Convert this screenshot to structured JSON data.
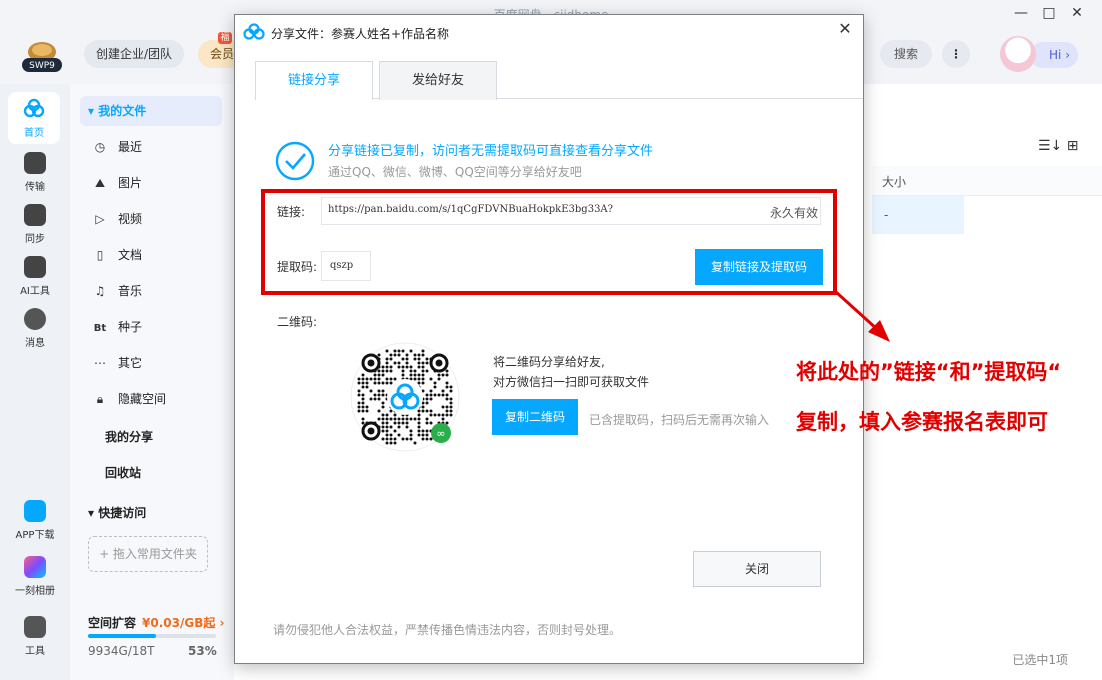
{
  "window": {
    "title": "百度网盘 - cjidhome",
    "controls": [
      "—",
      "□",
      "✕"
    ]
  },
  "topbar": {
    "team_label": "创建企业/团队",
    "vip_label": "会员",
    "vip_tag": "福",
    "search_label": "搜索",
    "more_label": "⋮",
    "hi_label": "Hi ›"
  },
  "sidebar": [
    {
      "label": "首页",
      "icon": "cloud-icon",
      "color": "#06a7ff"
    },
    {
      "label": "传输",
      "icon": "transfer-icon",
      "color": "#444"
    },
    {
      "label": "同步",
      "icon": "sync-icon",
      "color": "#444"
    },
    {
      "label": "AI工具",
      "icon": "ai-icon",
      "color": "#444"
    },
    {
      "label": "消息",
      "icon": "message-icon",
      "color": "#444"
    },
    {
      "label": "APP下载",
      "icon": "phone-icon",
      "color": "#06a7ff"
    },
    {
      "label": "一刻相册",
      "icon": "album-icon",
      "color": "#7b4dff"
    },
    {
      "label": "工具",
      "icon": "grid-icon",
      "color": "#444"
    }
  ],
  "nav": {
    "my_files": "▾ 我的文件",
    "items": [
      {
        "icon": "◷",
        "label": "最近"
      },
      {
        "icon": "⛰",
        "label": "图片"
      },
      {
        "icon": "▷",
        "label": "视频"
      },
      {
        "icon": "▯",
        "label": "文档"
      },
      {
        "icon": "♫",
        "label": "音乐"
      },
      {
        "icon": "Bt",
        "label": "种子"
      },
      {
        "icon": "⋯",
        "label": "其它"
      },
      {
        "icon": "🔒︎",
        "label": "隐藏空间"
      }
    ],
    "my_share": "我的分享",
    "recycle": "回收站",
    "quick_access": "▾  快捷访问",
    "drop_hint": "+ 拖入常用文件夹",
    "storage_title": "空间扩容",
    "storage_price": "¥0.03/GB起 ›",
    "storage_used": "9934G/18T",
    "storage_pct": "53%",
    "storage_fraction": 0.53
  },
  "main": {
    "col_size": "大小",
    "selected_size": "-",
    "status": "已选中1项",
    "view_icons": "☰↓  ⊞"
  },
  "dialog": {
    "title": "分享文件：参赛人姓名+作品名称",
    "close": "✕",
    "tabs": [
      "链接分享",
      "发给好友"
    ],
    "success_title": "分享链接已复制，访问者无需提取码可直接查看分享文件",
    "success_sub": "通过QQ、微信、微博、QQ空间等分享给好友吧",
    "link_label": "链接:",
    "link_url": "https://pan.baidu.com/s/1qCgFDVNBuaHokpkE3bg33A?",
    "link_validity": "永久有效",
    "code_label": "提取码:",
    "code_value": "qszp",
    "copy_button": "复制链接及提取码",
    "qr_label": "二维码:",
    "qr_desc1": "将二维码分享给好友,",
    "qr_desc2": "对方微信扫一扫即可获取文件",
    "qr_button": "复制二维码",
    "qr_note": "已含提取码，扫码后无需再次输入",
    "close_button": "关闭",
    "footer": "请勿侵犯他人合法权益，严禁传播色情违法内容，否则封号处理。"
  },
  "annotation": {
    "line1": "将此处的”链接“和”提取码“",
    "line2": "复制，填入参赛报名表即可",
    "color": "#e10000"
  },
  "colors": {
    "accent": "#06a7ff",
    "annotation": "#e10000"
  }
}
